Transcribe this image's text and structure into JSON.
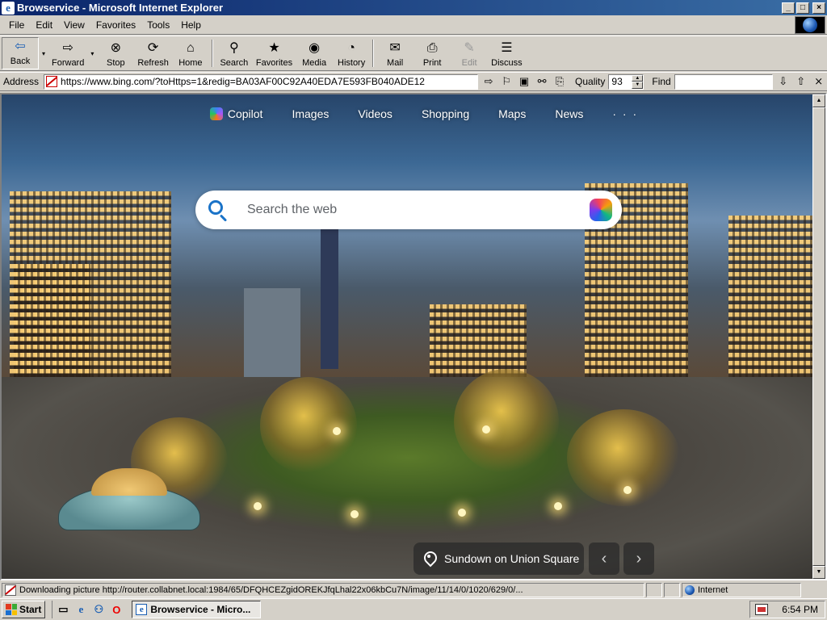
{
  "window": {
    "title": "Browservice - Microsoft Internet Explorer",
    "app_icon_glyph": "e",
    "controls": {
      "minimize": "_",
      "maximize": "□",
      "close": "×"
    }
  },
  "menu": {
    "items": [
      "File",
      "Edit",
      "View",
      "Favorites",
      "Tools",
      "Help"
    ]
  },
  "toolbar": {
    "buttons": [
      {
        "label": "Back",
        "icon": "back-arrow-icon",
        "glyph": "⇦",
        "pressed": true,
        "dropdown": true
      },
      {
        "label": "Forward",
        "icon": "forward-arrow-icon",
        "glyph": "⇨",
        "dropdown": true
      },
      {
        "label": "Stop",
        "icon": "stop-icon",
        "glyph": "⊗"
      },
      {
        "label": "Refresh",
        "icon": "refresh-icon",
        "glyph": "⟳"
      },
      {
        "label": "Home",
        "icon": "home-icon",
        "glyph": "⌂"
      },
      {
        "label": "Search",
        "icon": "search-icon",
        "glyph": "⚲"
      },
      {
        "label": "Favorites",
        "icon": "favorites-icon",
        "glyph": "★"
      },
      {
        "label": "Media",
        "icon": "media-icon",
        "glyph": "◉"
      },
      {
        "label": "History",
        "icon": "history-icon",
        "glyph": "◔"
      },
      {
        "label": "Mail",
        "icon": "mail-icon",
        "glyph": "✉",
        "dropdown": true
      },
      {
        "label": "Print",
        "icon": "print-icon",
        "glyph": "⎙"
      },
      {
        "label": "Edit",
        "icon": "edit-icon",
        "glyph": "✎",
        "disabled": true
      },
      {
        "label": "Discuss",
        "icon": "discuss-icon",
        "glyph": "☰"
      }
    ],
    "dropdown_glyph": "▾"
  },
  "address": {
    "label": "Address",
    "url": "https://www.bing.com/?toHttps=1&redig=BA03AF00C92A40EDA7E593FB040ADE12",
    "go_glyph": "⇨",
    "bookmark_glyph": "⚐",
    "tool_glyphs": [
      "▣",
      "⚯",
      "⎘"
    ],
    "quality_label": "Quality",
    "quality_value": "93",
    "spin_up": "▲",
    "spin_down": "▼",
    "find_label": "Find",
    "find_value": "",
    "find_next_glyph": "⇩",
    "find_prev_glyph": "⇧",
    "find_close_glyph": "⨯"
  },
  "bing": {
    "nav": {
      "copilot": "Copilot",
      "images": "Images",
      "videos": "Videos",
      "shopping": "Shopping",
      "maps": "Maps",
      "news": "News",
      "more": "· · ·"
    },
    "search_placeholder": "Search the web",
    "caption": "Sundown on Union Square",
    "prev_glyph": "‹",
    "next_glyph": "›"
  },
  "status": {
    "text": "Downloading picture http://router.collabnet.local:1984/65/DFQHCEZgidOREKJfqLhal22x06kbCu7N/image/11/14/0/1020/629/0/...",
    "zone": "Internet"
  },
  "taskbar": {
    "start": "Start",
    "quick_launch": [
      {
        "icon": "desktop-icon",
        "glyph": "▭"
      },
      {
        "icon": "ie-icon",
        "glyph": "e"
      },
      {
        "icon": "network-icon",
        "glyph": "⚇"
      },
      {
        "icon": "opera-icon",
        "glyph": "O"
      }
    ],
    "window_button": "Browservice - Micro...",
    "clock": "6:54 PM"
  }
}
